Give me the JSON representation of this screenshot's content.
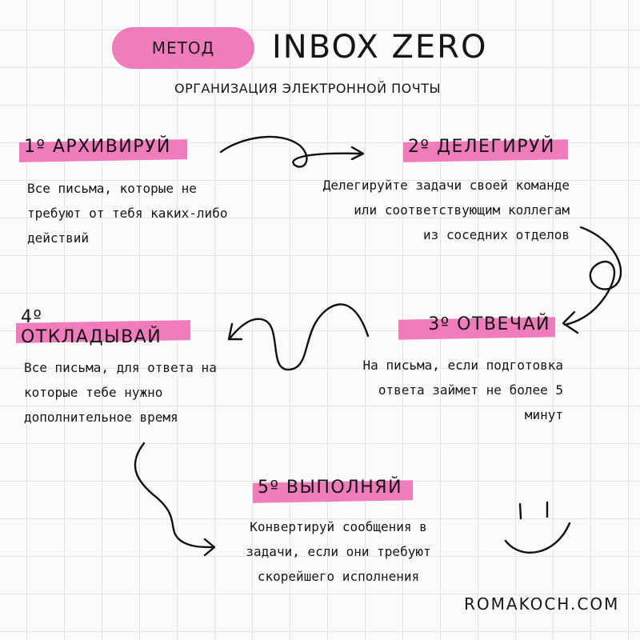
{
  "header": {
    "badge": "МЕТОД",
    "title": "INBOX ZERO",
    "subtitle": "ОРГАНИЗАЦИЯ ЭЛЕКТРОННОЙ ПОЧТЫ"
  },
  "steps": [
    {
      "title": "1º АРХИВИРУЙ",
      "text": "Все письма, которые не\nтребуют от тебя каких-либо\nдействий"
    },
    {
      "title": "2º ДЕЛЕГИРУЙ",
      "text": "Делегируйте задачи своей команде\nили соответствующим коллегам\nиз соседних отделов"
    },
    {
      "title": "3º ОТВЕЧАЙ",
      "text": "На письма, если подготовка\nответа займет не более 5\nминут"
    },
    {
      "title": "4º ОТКЛАДЫВАЙ",
      "text": "Все письма, для ответа на\nкоторые тебе нужно\nдополнительное время"
    },
    {
      "title": "5º ВЫПОЛНЯЙ",
      "text": "Конвертируй сообщения в\nзадачи, если они требуют\nскорейшего исполнения"
    }
  ],
  "footer": {
    "site": "ROMAKOCH.COM"
  },
  "colors": {
    "accent": "#f07cbb",
    "ink": "#151515",
    "grid": "#e4e4e4"
  },
  "icons": [
    "arrow-1-to-2-icon",
    "arrow-2-to-3-icon",
    "arrow-3-to-4-icon",
    "arrow-4-to-5-icon",
    "smiley-icon"
  ]
}
